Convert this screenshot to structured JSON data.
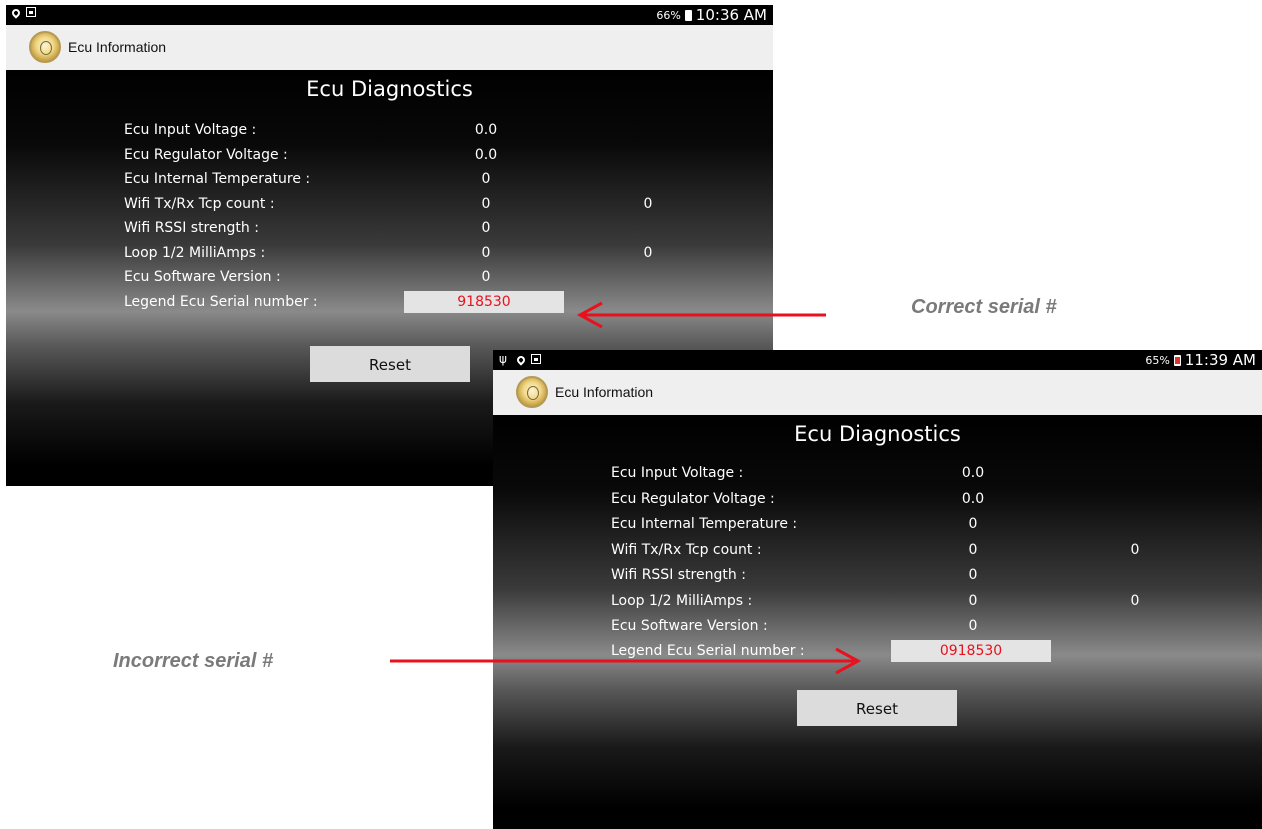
{
  "screen_correct": {
    "status": {
      "battery_pct": "66%",
      "time": "10:36 AM"
    },
    "app_title": "Ecu Information",
    "page_title": "Ecu Diagnostics",
    "rows": [
      {
        "label": "Ecu Input Voltage :",
        "v1": "0.0",
        "v2": ""
      },
      {
        "label": "Ecu Regulator Voltage :",
        "v1": "0.0",
        "v2": ""
      },
      {
        "label": "Ecu Internal Temperature :",
        "v1": "0",
        "v2": ""
      },
      {
        "label": "Wifi Tx/Rx Tcp count :",
        "v1": "0",
        "v2": "0"
      },
      {
        "label": "Wifi RSSI strength :",
        "v1": "0",
        "v2": ""
      },
      {
        "label": "Loop 1/2 MilliAmps :",
        "v1": "0",
        "v2": "0"
      },
      {
        "label": "Ecu Software Version :",
        "v1": "0",
        "v2": ""
      }
    ],
    "serial_label": "Legend Ecu Serial number :",
    "serial_value": "918530",
    "reset_label": "Reset"
  },
  "screen_incorrect": {
    "status": {
      "battery_pct": "65%",
      "time": "11:39 AM"
    },
    "app_title": "Ecu Information",
    "page_title": "Ecu Diagnostics",
    "rows": [
      {
        "label": "Ecu Input Voltage :",
        "v1": "0.0",
        "v2": ""
      },
      {
        "label": "Ecu Regulator Voltage :",
        "v1": "0.0",
        "v2": ""
      },
      {
        "label": "Ecu Internal Temperature :",
        "v1": "0",
        "v2": ""
      },
      {
        "label": "Wifi Tx/Rx Tcp count :",
        "v1": "0",
        "v2": "0"
      },
      {
        "label": "Wifi RSSI strength :",
        "v1": "0",
        "v2": ""
      },
      {
        "label": "Loop 1/2 MilliAmps :",
        "v1": "0",
        "v2": "0"
      },
      {
        "label": "Ecu Software Version :",
        "v1": "0",
        "v2": ""
      }
    ],
    "serial_label": "Legend Ecu Serial number :",
    "serial_value": "0918530",
    "reset_label": "Reset"
  },
  "annotations": {
    "correct": "Correct serial #",
    "incorrect": "Incorrect serial #",
    "arrow_color": "#e8111e"
  },
  "icons": [
    "location-pin-icon",
    "gallery-icon",
    "usb-icon",
    "battery-icon",
    "app-logo-icon"
  ]
}
